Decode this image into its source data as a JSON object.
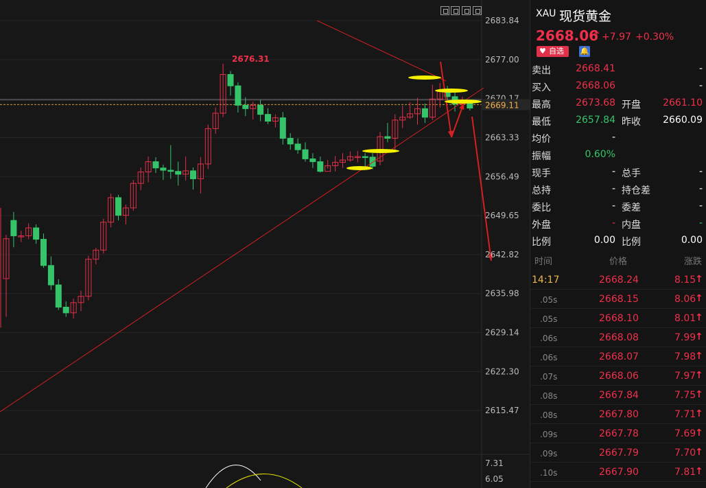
{
  "chart": {
    "high_label": "2676.31",
    "current_level": "2669.11",
    "axis_labels": [
      "2683.84",
      "2677.00",
      "2670.17",
      "2663.33",
      "2656.49",
      "2649.65",
      "2642.82",
      "2635.98",
      "2629.14",
      "2622.30",
      "2615.47"
    ],
    "indicator_labels": [
      "7.31",
      "6.05"
    ],
    "colors": {
      "up": "#e0304a",
      "down": "#36c46b",
      "trend": "#d42020",
      "marker": "#f5f000"
    }
  },
  "header": {
    "code": "XAU",
    "name": "现货黄金",
    "price": "2668.06",
    "change": "+7.97",
    "percent": "+0.30%",
    "fav_label": "自选"
  },
  "quote": [
    {
      "l1": "卖出",
      "v1": "2668.41",
      "c1": "red",
      "l2": "",
      "v2": "-",
      "c2": "white"
    },
    {
      "l1": "买入",
      "v1": "2668.06",
      "c1": "red",
      "l2": "",
      "v2": "-",
      "c2": "white"
    },
    {
      "l1": "最高",
      "v1": "2673.68",
      "c1": "red",
      "l2": "开盘",
      "v2": "2661.10",
      "c2": "red"
    },
    {
      "l1": "最低",
      "v1": "2657.84",
      "c1": "green",
      "l2": "昨收",
      "v2": "2660.09",
      "c2": "white"
    },
    {
      "l1": "均价",
      "v1": "-",
      "c1": "white",
      "l2": "",
      "v2": "",
      "c2": "white"
    },
    {
      "l1": "振幅",
      "v1": "0.60%",
      "c1": "green",
      "l2": "",
      "v2": "",
      "c2": "white"
    },
    {
      "l1": "现手",
      "v1": "-",
      "c1": "white",
      "l2": "总手",
      "v2": "-",
      "c2": "white"
    },
    {
      "l1": "总持",
      "v1": "-",
      "c1": "white",
      "l2": "持仓差",
      "v2": "-",
      "c2": "white"
    },
    {
      "l1": "委比",
      "v1": "-",
      "c1": "white",
      "l2": "委差",
      "v2": "-",
      "c2": "white"
    },
    {
      "l1": "外盘",
      "v1": "-",
      "c1": "red",
      "l2": "内盘",
      "v2": "-",
      "c2": "green"
    },
    {
      "l1": "比例",
      "v1": "0.00",
      "c1": "white",
      "l2": "比例",
      "v2": "0.00",
      "c2": "white"
    }
  ],
  "ticks_header": {
    "time": "时间",
    "price": "价格",
    "change": "涨跌"
  },
  "ticks": [
    {
      "time": "14:17",
      "price": "2668.24",
      "change": "8.15"
    },
    {
      "time": ".05s",
      "price": "2668.15",
      "change": "8.06"
    },
    {
      "time": ".05s",
      "price": "2668.10",
      "change": "8.01"
    },
    {
      "time": ".06s",
      "price": "2668.08",
      "change": "7.99"
    },
    {
      "time": ".06s",
      "price": "2668.07",
      "change": "7.98"
    },
    {
      "time": ".07s",
      "price": "2668.06",
      "change": "7.97"
    },
    {
      "time": ".08s",
      "price": "2667.84",
      "change": "7.75"
    },
    {
      "time": ".08s",
      "price": "2667.80",
      "change": "7.71"
    },
    {
      "time": ".09s",
      "price": "2667.78",
      "change": "7.69"
    },
    {
      "time": ".09s",
      "price": "2667.79",
      "change": "7.70"
    },
    {
      "time": ".10s",
      "price": "2667.90",
      "change": "7.81"
    }
  ],
  "candles": [
    [
      2638.6,
      2645.6,
      2631.9,
      2646.3
    ],
    [
      2648.8,
      2646.1,
      2644.1,
      2650.3
    ],
    [
      2646.1,
      2646.1,
      2645.0,
      2647.0
    ],
    [
      2646.1,
      2647.5,
      2645.5,
      2648.3
    ],
    [
      2647.5,
      2645.5,
      2644.7,
      2648.1
    ],
    [
      2645.5,
      2640.9,
      2640.5,
      2646.5
    ],
    [
      2640.9,
      2637.5,
      2636.6,
      2642.5
    ],
    [
      2637.5,
      2633.6,
      2633.1,
      2638.5
    ],
    [
      2633.6,
      2632.6,
      2631.9,
      2634.6
    ],
    [
      2632.6,
      2634.4,
      2631.6,
      2635.1
    ],
    [
      2634.4,
      2635.5,
      2632.9,
      2636.5
    ],
    [
      2635.5,
      2642.0,
      2634.8,
      2642.6
    ],
    [
      2642.0,
      2643.6,
      2641.1,
      2644.0
    ],
    [
      2643.6,
      2648.5,
      2643.0,
      2649.1
    ],
    [
      2648.5,
      2652.8,
      2647.6,
      2653.5
    ],
    [
      2652.8,
      2649.7,
      2648.8,
      2653.3
    ],
    [
      2649.7,
      2651.0,
      2648.1,
      2651.6
    ],
    [
      2651.0,
      2655.3,
      2650.5,
      2655.9
    ],
    [
      2655.3,
      2657.3,
      2654.1,
      2658.1
    ],
    [
      2657.3,
      2659.1,
      2655.5,
      2660.0
    ],
    [
      2659.1,
      2658.0,
      2657.1,
      2659.9
    ],
    [
      2658.0,
      2657.6,
      2655.9,
      2658.6
    ],
    [
      2657.6,
      2657.4,
      2656.1,
      2662.0
    ],
    [
      2657.4,
      2656.9,
      2654.9,
      2659.1
    ],
    [
      2656.9,
      2657.5,
      2655.8,
      2660.0
    ],
    [
      2657.5,
      2656.1,
      2654.2,
      2658.1
    ],
    [
      2656.1,
      2658.7,
      2653.5,
      2659.9
    ],
    [
      2658.7,
      2664.9,
      2657.8,
      2665.6
    ],
    [
      2664.9,
      2667.6,
      2664.0,
      2668.6
    ],
    [
      2667.6,
      2674.4,
      2666.9,
      2676.3
    ],
    [
      2674.4,
      2672.4,
      2670.7,
      2675.0
    ],
    [
      2672.4,
      2669.0,
      2667.7,
      2673.0
    ],
    [
      2669.0,
      2668.4,
      2667.1,
      2670.4
    ],
    [
      2668.4,
      2669.0,
      2666.5,
      2669.6
    ],
    [
      2669.0,
      2667.4,
      2666.2,
      2670.0
    ],
    [
      2667.4,
      2666.2,
      2665.7,
      2668.5
    ],
    [
      2666.2,
      2666.8,
      2665.1,
      2667.4
    ],
    [
      2666.8,
      2663.2,
      2662.1,
      2667.8
    ],
    [
      2663.2,
      2662.2,
      2661.2,
      2664.1
    ],
    [
      2662.2,
      2661.2,
      2660.5,
      2663.2
    ],
    [
      2661.2,
      2659.6,
      2659.1,
      2662.5
    ],
    [
      2659.6,
      2659.1,
      2658.0,
      2660.6
    ],
    [
      2659.1,
      2657.4,
      2657.2,
      2660.0
    ],
    [
      2657.4,
      2658.4,
      2657.9,
      2659.4
    ],
    [
      2658.4,
      2659.0,
      2657.4,
      2660.1
    ],
    [
      2659.0,
      2659.4,
      2658.0,
      2660.6
    ],
    [
      2659.4,
      2660.0,
      2659.1,
      2660.9
    ],
    [
      2660.0,
      2660.0,
      2659.0,
      2661.0
    ],
    [
      2660.0,
      2659.9,
      2658.0,
      2660.6
    ],
    [
      2659.9,
      2658.3,
      2657.8,
      2660.6
    ],
    [
      2659.2,
      2663.5,
      2658.5,
      2664.3
    ],
    [
      2663.5,
      2663.2,
      2662.5,
      2665.9
    ],
    [
      2663.2,
      2666.4,
      2661.0,
      2667.4
    ],
    [
      2666.4,
      2666.9,
      2665.0,
      2668.9
    ],
    [
      2666.9,
      2667.5,
      2666.6,
      2669.5
    ],
    [
      2667.5,
      2668.4,
      2665.6,
      2670.3
    ],
    [
      2668.4,
      2666.9,
      2665.9,
      2669.3
    ],
    [
      2666.9,
      2670.1,
      2666.4,
      2672.6
    ],
    [
      2670.1,
      2671.4,
      2668.6,
      2672.9
    ],
    [
      2671.4,
      2670.5,
      2669.6,
      2672.4
    ],
    [
      2670.5,
      2669.2,
      2667.9,
      2671.5
    ],
    [
      2669.2,
      2669.6,
      2668.5,
      2670.5
    ],
    [
      2669.6,
      2668.5,
      2668.1,
      2670.0
    ]
  ]
}
